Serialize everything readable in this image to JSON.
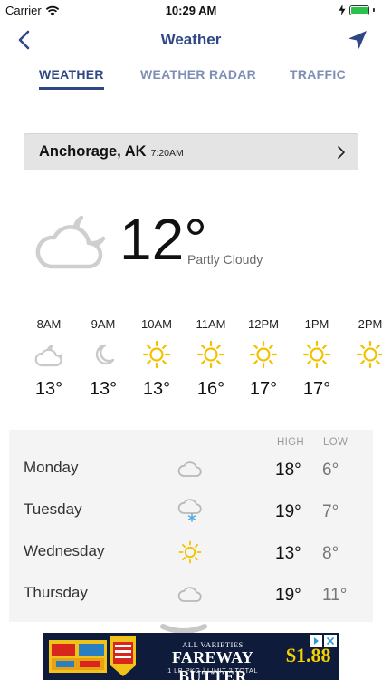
{
  "status_bar": {
    "carrier": "Carrier",
    "time": "10:29 AM",
    "battery_color": "#2bc24b"
  },
  "nav": {
    "title": "Weather",
    "back_icon": "chevron-left-icon",
    "location_icon": "location-arrow-icon"
  },
  "tabs": [
    {
      "label": "WEATHER",
      "active": true
    },
    {
      "label": "WEATHER RADAR",
      "active": false
    },
    {
      "label": "TRAFFIC",
      "active": false
    }
  ],
  "location": {
    "city": "Anchorage, AK",
    "local_time": "7:20AM"
  },
  "current": {
    "temperature": "12°",
    "condition": "Partly Cloudy",
    "icon": "partly-cloudy-night-icon"
  },
  "hourly": [
    {
      "time": "8AM",
      "temp": "13°",
      "icon": "partly-cloudy-night-icon"
    },
    {
      "time": "9AM",
      "temp": "13°",
      "icon": "moon-icon"
    },
    {
      "time": "10AM",
      "temp": "13°",
      "icon": "sun-icon"
    },
    {
      "time": "11AM",
      "temp": "16°",
      "icon": "sun-icon"
    },
    {
      "time": "12PM",
      "temp": "17°",
      "icon": "sun-icon"
    },
    {
      "time": "1PM",
      "temp": "17°",
      "icon": "sun-icon"
    },
    {
      "time": "2PM",
      "temp": "",
      "icon": "sun-icon"
    }
  ],
  "daily": {
    "high_header": "HIGH",
    "low_header": "LOW",
    "days": [
      {
        "name": "Monday",
        "high": "18°",
        "low": "6°",
        "icon": "cloud-icon"
      },
      {
        "name": "Tuesday",
        "high": "19°",
        "low": "7°",
        "icon": "cloud-snow-icon"
      },
      {
        "name": "Wednesday",
        "high": "13°",
        "low": "8°",
        "icon": "sun-icon"
      },
      {
        "name": "Thursday",
        "high": "19°",
        "low": "11°",
        "icon": "cloud-icon"
      }
    ]
  },
  "ad": {
    "subtitle": "ALL VARIETIES",
    "headline": "FAREWAY BUTTER",
    "fine_print": "1 LB PKG | LIMIT 2 TOTAL",
    "price": "$1.88",
    "price_color": "#f4d200",
    "background_color": "#0e1b3b"
  },
  "colors": {
    "accent": "#2f4785",
    "tab_inactive": "#7f8fb4",
    "sun": "#f2c200"
  }
}
